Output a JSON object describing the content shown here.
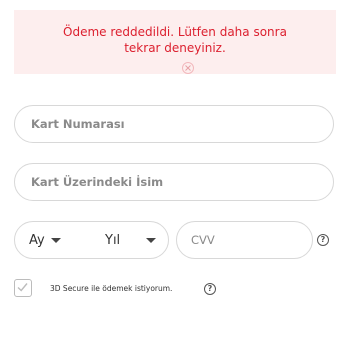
{
  "alert": {
    "message": "Ödeme reddedildi. Lütfen daha sonra tekrar deneyiniz.",
    "close_icon": "close-icon"
  },
  "form": {
    "card_number": {
      "placeholder": "Kart Numarası"
    },
    "card_name": {
      "placeholder": "Kart Üzerindeki İsim"
    },
    "expiry": {
      "month_label": "Ay",
      "year_label": "Yıl"
    },
    "cvv": {
      "placeholder": "CVV"
    },
    "secure_3d": {
      "label": "3D Secure ile ödemek istiyorum.",
      "checked": true
    }
  },
  "colors": {
    "alert_background": "#fdeeee",
    "alert_text": "#dc1f2e",
    "border": "#d8d8d8"
  }
}
